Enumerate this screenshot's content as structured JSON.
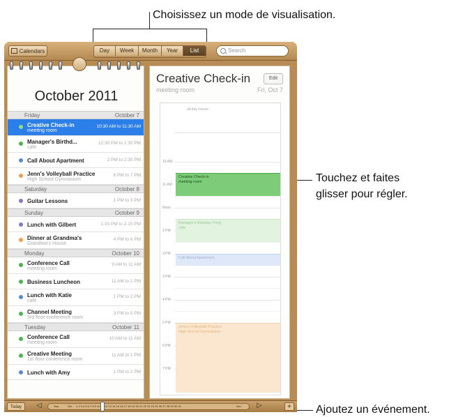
{
  "callouts": {
    "view_mode": "Choisissez un mode de visualisation.",
    "drag_line1": "Touchez et faites",
    "drag_line2": "glisser pour régler.",
    "add_event": "Ajoutez un événement."
  },
  "toolbar": {
    "calendars_label": "Calendars",
    "views": [
      "Day",
      "Week",
      "Month",
      "Year",
      "List"
    ],
    "active_view": "List",
    "search_placeholder": "Search"
  },
  "list": {
    "month_title": "October 2011",
    "sections": [
      {
        "day": "Friday",
        "date": "October 7",
        "events": [
          {
            "name": "Creative Check-in",
            "loc": "meeting room",
            "time": "10:30 AM to 11:30 AM",
            "color": "#4cb64c",
            "selected": true
          },
          {
            "name": "Manager's Birthd...",
            "loc": "cafe",
            "time": "12:30 PM to 1:30 PM",
            "color": "#4cb64c"
          },
          {
            "name": "Call About Apartment",
            "loc": "",
            "time": "2 PM to 2:30 PM",
            "color": "#5c86d6"
          },
          {
            "name": "Jenn's Volleyball Practice",
            "loc": "High School Gymnasium",
            "time": "6 PM to 7 PM",
            "color": "#f0a049"
          }
        ]
      },
      {
        "day": "Saturday",
        "date": "October 8",
        "events": [
          {
            "name": "Guitar Lessons",
            "loc": "",
            "time": "1 PM to 3 PM",
            "color": "#8c75c6"
          }
        ]
      },
      {
        "day": "Sunday",
        "date": "October 9",
        "events": [
          {
            "name": "Lunch with Gilbert",
            "loc": "",
            "time": "1:15 PM to 2:15 PM",
            "color": "#8c75c6"
          },
          {
            "name": "Dinner at Grandma's",
            "loc": "Grandma's House",
            "time": "4 PM to 6 PM",
            "color": "#f0a049"
          }
        ]
      },
      {
        "day": "Monday",
        "date": "October 10",
        "events": [
          {
            "name": "Conference Call",
            "loc": "meeting room",
            "time": "9 AM to 11 AM",
            "color": "#4cb64c"
          },
          {
            "name": "Business Luncheon",
            "loc": "",
            "time": "11 AM to 1 PM",
            "color": "#4cb64c"
          },
          {
            "name": "Lunch with Katie",
            "loc": "cafe",
            "time": "1 PM to 2 PM",
            "color": "#5c86d6"
          },
          {
            "name": "Channel Meeting",
            "loc": "3rd floor conference room",
            "time": "3 PM to 5 PM",
            "color": "#4cb64c"
          }
        ]
      },
      {
        "day": "Tuesday",
        "date": "October 11",
        "events": [
          {
            "name": "Conference Call",
            "loc": "meeting room",
            "time": "10 AM to 11 AM",
            "color": "#4cb64c"
          },
          {
            "name": "Creative Meeting",
            "loc": "1st floor conference room",
            "time": "11 AM to 1 PM",
            "color": "#4cb64c"
          },
          {
            "name": "Lunch with Amy",
            "loc": "",
            "time": "1 PM to 2 PM",
            "color": "#5c86d6"
          }
        ]
      }
    ]
  },
  "detail": {
    "title": "Creative Check-in",
    "edit_label": "Edit",
    "location": "meeting room",
    "date": "Fri, Oct 7",
    "allday_label": "all-day events",
    "hours": [
      "10 AM",
      "11 AM",
      "Noon",
      "1 PM",
      "2 PM",
      "3 PM",
      "4 PM",
      "5 PM",
      "6 PM",
      "7 PM"
    ],
    "blocks": [
      {
        "name": "Creative Check-in",
        "loc": "meeting room",
        "bg": "#7dcc79",
        "fg": "#1f4d1c",
        "border": "#4ea64a"
      },
      {
        "name": "Manager's Birthday Party",
        "loc": "cafe",
        "bg": "#e2f3e0",
        "fg": "#9cc798",
        "border": "#c8e6c4"
      },
      {
        "name": "Call About Apartment",
        "loc": "",
        "bg": "#dfe8f8",
        "fg": "#9eb2d8",
        "border": "#c2d2ef"
      },
      {
        "name": "Jenn's Volleyball Practice",
        "loc": "High School Gymnasium",
        "bg": "#fbe7cf",
        "fg": "#e5b37d",
        "border": "#f1d2ac"
      }
    ]
  },
  "bottombar": {
    "today_label": "Today",
    "prev_arrow": "◁",
    "next_arrow": "▷",
    "sep_label": "Sep",
    "oct_label": "Oct",
    "nov_label": "Nov",
    "day_numbers": "1 2 3 4 5 6 7 8 9 10 11 12 13 14 15 16 17 18 19 20 21 22 23 24 25 26 27 28 29 30 31",
    "add_label": "+"
  }
}
